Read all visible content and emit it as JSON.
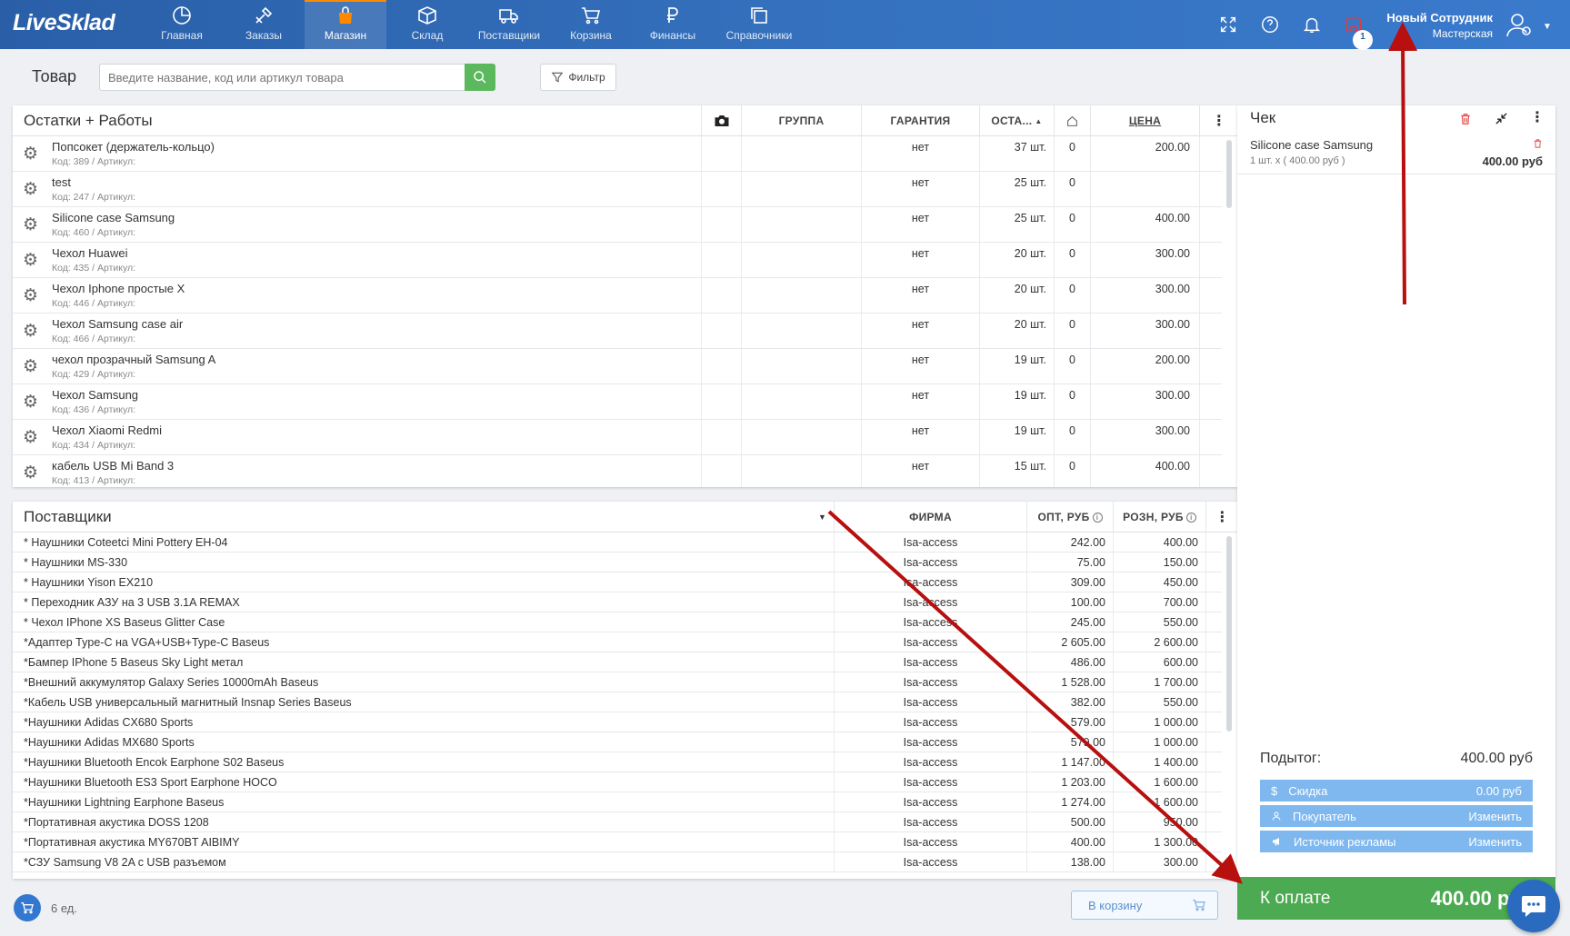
{
  "app": {
    "logo": "LiveSklad",
    "nav": [
      {
        "label": "Главная",
        "icon": "chart-pie-icon"
      },
      {
        "label": "Заказы",
        "icon": "tools-icon"
      },
      {
        "label": "Магазин",
        "icon": "bag-icon",
        "active": true
      },
      {
        "label": "Склад",
        "icon": "box-icon"
      },
      {
        "label": "Поставщики",
        "icon": "truck-icon"
      },
      {
        "label": "Корзина",
        "icon": "cart-icon"
      },
      {
        "label": "Финансы",
        "icon": "ruble-icon"
      },
      {
        "label": "Справочники",
        "icon": "copy-icon"
      }
    ],
    "notifications_badge": "1",
    "user_name": "Новый Сотрудник",
    "user_location": "Мастерская",
    "accent_color": "#2a5fa8",
    "active_tab_color": "#ff8a00"
  },
  "search": {
    "title": "Товар",
    "placeholder": "Введите название, код или артикул товара",
    "filter_label": "Фильтр"
  },
  "stock": {
    "title": "Остатки + Работы",
    "columns": {
      "group": "ГРУППА",
      "warranty": "ГАРАНТИЯ",
      "stock": "ОСТА...",
      "price": "ЦЕНА"
    },
    "rows": [
      {
        "name": "Попсокет (держатель-кольцо)",
        "meta": "Код: 389 /  Артикул:",
        "warranty": "нет",
        "qty": "37 шт.",
        "shop": "0",
        "price": "200.00"
      },
      {
        "name": "test",
        "meta": "Код: 247 /  Артикул:",
        "warranty": "нет",
        "qty": "25 шт.",
        "shop": "0",
        "price": ""
      },
      {
        "name": "Silicone case Samsung",
        "meta": "Код: 460 /  Артикул:",
        "warranty": "нет",
        "qty": "25 шт.",
        "shop": "0",
        "price": "400.00"
      },
      {
        "name": "Чехол Huawei",
        "meta": "Код: 435 /  Артикул:",
        "warranty": "нет",
        "qty": "20 шт.",
        "shop": "0",
        "price": "300.00"
      },
      {
        "name": "Чехол Iphone простые X",
        "meta": "Код: 446 /  Артикул:",
        "warranty": "нет",
        "qty": "20 шт.",
        "shop": "0",
        "price": "300.00"
      },
      {
        "name": "Чехол Samsung case air",
        "meta": "Код: 466 /  Артикул:",
        "warranty": "нет",
        "qty": "20 шт.",
        "shop": "0",
        "price": "300.00"
      },
      {
        "name": "чехол прозрачный Samsung A",
        "meta": "Код: 429 /  Артикул:",
        "warranty": "нет",
        "qty": "19 шт.",
        "shop": "0",
        "price": "200.00"
      },
      {
        "name": "Чехол Samsung",
        "meta": "Код: 436 /  Артикул:",
        "warranty": "нет",
        "qty": "19 шт.",
        "shop": "0",
        "price": "300.00"
      },
      {
        "name": "Чехол Xiaomi Redmi",
        "meta": "Код: 434 /  Артикул:",
        "warranty": "нет",
        "qty": "19 шт.",
        "shop": "0",
        "price": "300.00"
      },
      {
        "name": "кабель USB Mi Band 3",
        "meta": "Код: 413 /  Артикул:",
        "warranty": "нет",
        "qty": "15 шт.",
        "shop": "0",
        "price": "400.00"
      }
    ]
  },
  "suppliers": {
    "title": "Поставщики",
    "columns": {
      "firm": "ФИРМА",
      "wholesale": "ОПТ, РУБ",
      "retail": "РОЗН, РУБ"
    },
    "rows": [
      {
        "name": "* Наушники Coteetci Mini Pottery EH-04",
        "firm": "Isa-access",
        "opt": "242.00",
        "rozn": "400.00"
      },
      {
        "name": "* Наушники MS-330",
        "firm": "Isa-access",
        "opt": "75.00",
        "rozn": "150.00"
      },
      {
        "name": "* Наушники Yison EX210",
        "firm": "Isa-access",
        "opt": "309.00",
        "rozn": "450.00"
      },
      {
        "name": "* Переходник АЗУ на 3 USB 3.1A REMAX",
        "firm": "Isa-access",
        "opt": "100.00",
        "rozn": "700.00"
      },
      {
        "name": "* Чехол IPhone XS Baseus Glitter Case",
        "firm": "Isa-access",
        "opt": "245.00",
        "rozn": "550.00"
      },
      {
        "name": "*Адаптер Type-C на VGA+USB+Type-C Baseus",
        "firm": "Isa-access",
        "opt": "2 605.00",
        "rozn": "2 600.00"
      },
      {
        "name": "*Бампер IPhone 5 Baseus Sky Light метал",
        "firm": "Isa-access",
        "opt": "486.00",
        "rozn": "600.00"
      },
      {
        "name": "*Внешний аккумулятор Galaxy Series 10000mAh Baseus",
        "firm": "Isa-access",
        "opt": "1 528.00",
        "rozn": "1 700.00"
      },
      {
        "name": "*Кабель USB универсальный магнитный Insnap Series Baseus",
        "firm": "Isa-access",
        "opt": "382.00",
        "rozn": "550.00"
      },
      {
        "name": "*Наушники Adidas CX680 Sports",
        "firm": "Isa-access",
        "opt": "579.00",
        "rozn": "1 000.00"
      },
      {
        "name": "*Наушники Adidas MX680 Sports",
        "firm": "Isa-access",
        "opt": "579.00",
        "rozn": "1 000.00"
      },
      {
        "name": "*Наушники Bluetooth Encok Earphone S02 Baseus",
        "firm": "Isa-access",
        "opt": "1 147.00",
        "rozn": "1 400.00"
      },
      {
        "name": "*Наушники Bluetooth ES3 Sport Earphone HOCO",
        "firm": "Isa-access",
        "opt": "1 203.00",
        "rozn": "1 600.00"
      },
      {
        "name": "*Наушники Lightning Earphone Baseus",
        "firm": "Isa-access",
        "opt": "1 274.00",
        "rozn": "1 600.00"
      },
      {
        "name": "*Портативная акустика DOSS 1208",
        "firm": "Isa-access",
        "opt": "500.00",
        "rozn": "950.00"
      },
      {
        "name": "*Портативная акустика MY670BT AIBIMY",
        "firm": "Isa-access",
        "opt": "400.00",
        "rozn": "1 300.00"
      },
      {
        "name": "*СЗУ Samsung V8 2A с USB разъемом",
        "firm": "Isa-access",
        "opt": "138.00",
        "rozn": "300.00"
      }
    ]
  },
  "footer": {
    "count": "6 ед.",
    "to_cart": "В корзину"
  },
  "cheque": {
    "title": "Чек",
    "item": {
      "name": "Silicone case Samsung",
      "qty": "1 шт. x ( 400.00 руб )",
      "price": "400.00 руб"
    },
    "subtotal_label": "Подытог:",
    "subtotal_value": "400.00 руб",
    "discount_label": "Скидка",
    "discount_value": "0.00 руб",
    "buyer_label": "Покупатель",
    "buyer_action": "Изменить",
    "ad_label": "Источник рекламы",
    "ad_action": "Изменить",
    "pay_label": "К оплате",
    "pay_value": "400.00 руб"
  }
}
